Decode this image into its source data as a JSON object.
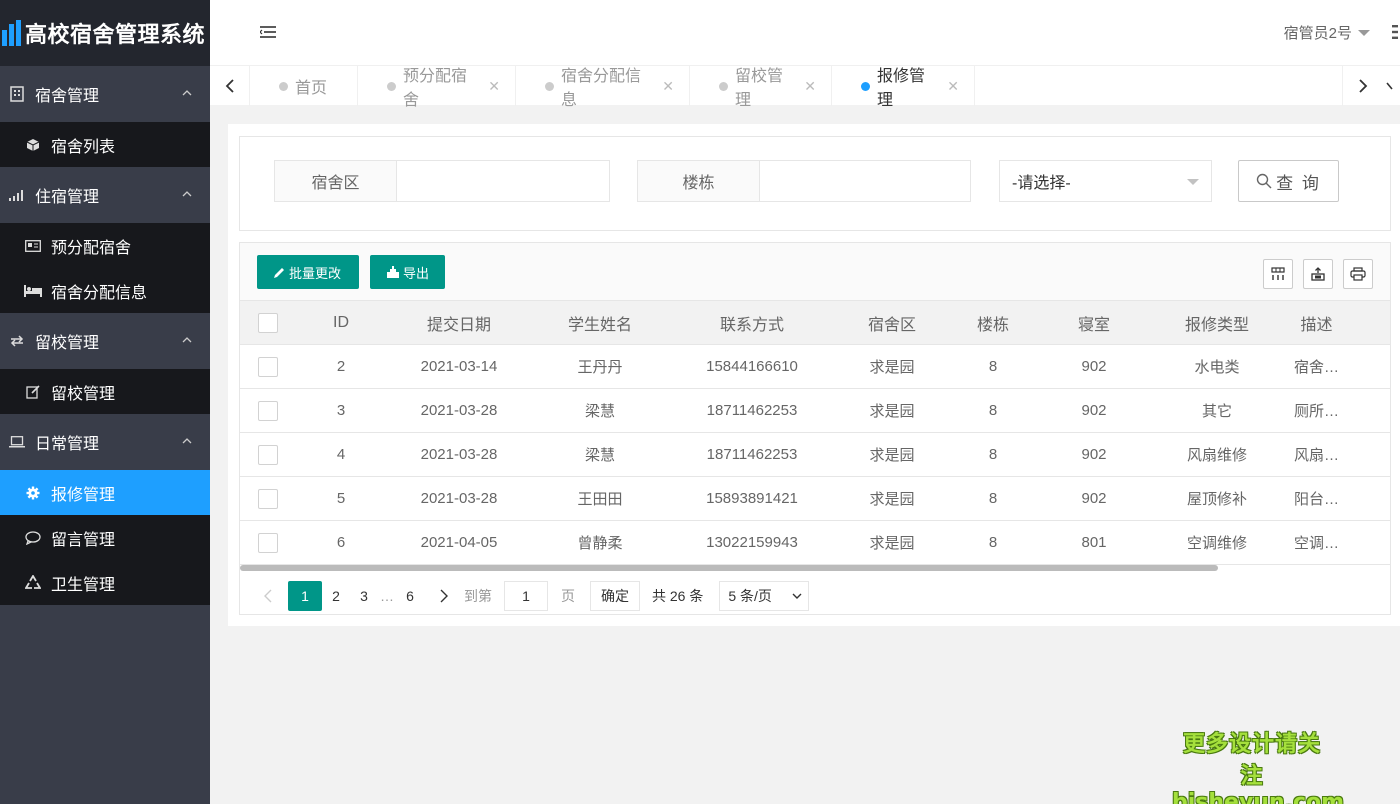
{
  "app": {
    "title": "高校宿舍管理系统"
  },
  "header": {
    "user": "宿管员2号"
  },
  "sidebar": {
    "groups": [
      {
        "label": "宿舍管理",
        "icon": "building-icon",
        "items": [
          {
            "label": "宿舍列表",
            "icon": "cube-icon"
          }
        ]
      },
      {
        "label": "住宿管理",
        "icon": "signal-icon",
        "items": [
          {
            "label": "预分配宿舍",
            "icon": "id-card-icon"
          },
          {
            "label": "宿舍分配信息",
            "icon": "bed-icon"
          }
        ]
      },
      {
        "label": "留校管理",
        "icon": "exchange-icon",
        "items": [
          {
            "label": "留校管理",
            "icon": "edit-icon"
          }
        ]
      },
      {
        "label": "日常管理",
        "icon": "laptop-icon",
        "items": [
          {
            "label": "报修管理",
            "icon": "gear-icon",
            "active": true
          },
          {
            "label": "留言管理",
            "icon": "comment-icon"
          },
          {
            "label": "卫生管理",
            "icon": "recycle-icon"
          }
        ]
      }
    ]
  },
  "tabs": [
    {
      "label": "首页",
      "closable": false,
      "active": false
    },
    {
      "label": "预分配宿舍",
      "closable": true,
      "active": false
    },
    {
      "label": "宿舍分配信息",
      "closable": true,
      "active": false
    },
    {
      "label": "留校管理",
      "closable": true,
      "active": false
    },
    {
      "label": "报修管理",
      "closable": true,
      "active": true
    }
  ],
  "search": {
    "dorm_area_label": "宿舍区",
    "building_label": "楼栋",
    "select_value": "-请选择-",
    "search_button": "查 询"
  },
  "toolbar": {
    "batch_label": "批量更改",
    "export_label": "导出"
  },
  "table": {
    "columns": [
      "ID",
      "提交日期",
      "学生姓名",
      "联系方式",
      "宿舍区",
      "楼栋",
      "寝室",
      "报修类型",
      "描述"
    ],
    "rows": [
      [
        "2",
        "2021-03-14",
        "王丹丹",
        "15844166610",
        "求是园",
        "8",
        "902",
        "水电类",
        "宿舍…"
      ],
      [
        "3",
        "2021-03-28",
        "梁慧",
        "18711462253",
        "求是园",
        "8",
        "902",
        "其它",
        "厕所…"
      ],
      [
        "4",
        "2021-03-28",
        "梁慧",
        "18711462253",
        "求是园",
        "8",
        "902",
        "风扇维修",
        "风扇…"
      ],
      [
        "5",
        "2021-03-28",
        "王田田",
        "15893891421",
        "求是园",
        "8",
        "902",
        "屋顶修补",
        "阳台…"
      ],
      [
        "6",
        "2021-04-05",
        "曾静柔",
        "13022159943",
        "求是园",
        "8",
        "801",
        "空调维修",
        "空调…"
      ]
    ]
  },
  "pager": {
    "pages": [
      "1",
      "2",
      "3"
    ],
    "ellipsis": "…",
    "last": "6",
    "goto_label": "到第",
    "goto_value": "1",
    "page_suffix": "页",
    "confirm": "确定",
    "total": "共 26 条",
    "per_page": "5 条/页"
  },
  "watermark": {
    "line1": "更多设计请关注",
    "line2": "bisheyun.com"
  },
  "colors": {
    "accent": "#009688",
    "active_nav": "#1e9fff",
    "sidebar_bg": "#393d49"
  }
}
